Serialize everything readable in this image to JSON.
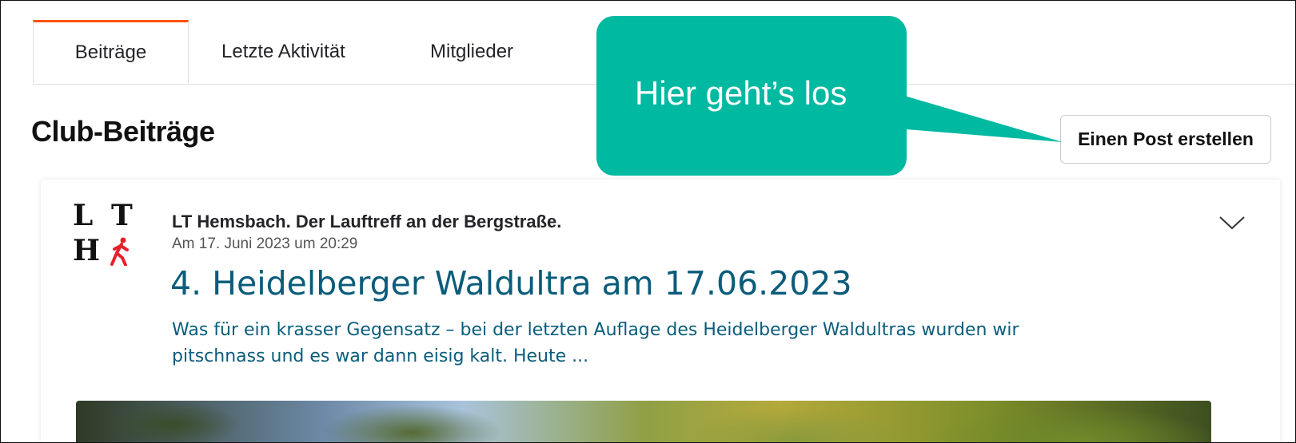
{
  "tabs": [
    {
      "label": "Beiträge",
      "active": true
    },
    {
      "label": "Letzte Aktivität",
      "active": false
    },
    {
      "label": "Mitglieder",
      "active": false
    }
  ],
  "page_title": "Club-Beiträge",
  "create_post_button": "Einen Post erstellen",
  "callout": {
    "text": "Hier geht’s los",
    "color": "#00b9a1"
  },
  "post": {
    "logo": {
      "letters": [
        "L",
        "T",
        "H"
      ],
      "icon": "runner-icon"
    },
    "club_name": "LT Hemsbach. Der Lauftreff an der Bergstraße.",
    "date": "Am 17. Juni 2023 um 20:29",
    "title": "4. Heidelberger Waldultra am 17.06.2023",
    "excerpt": "Was für ein krasser Gegensatz – bei der letzten Auflage des Heidelberger Waldultras wurden wir pitschnass und es war dann eisig kalt. Heute ...",
    "menu_icon": "chevron-down-icon"
  },
  "colors": {
    "accent": "#fc5200",
    "link": "#0a5c7b",
    "callout": "#00b9a1"
  }
}
